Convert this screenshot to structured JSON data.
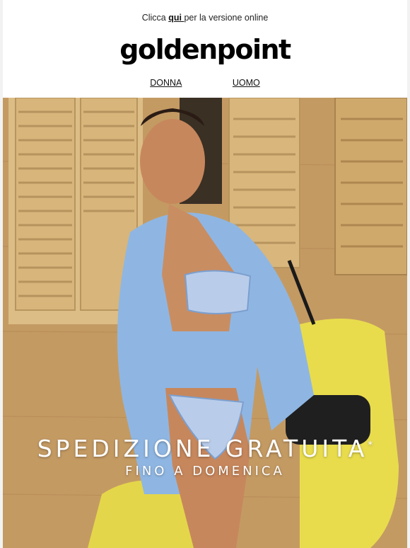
{
  "preheader": {
    "prefix": "Clicca ",
    "link": "qui ",
    "suffix": "per la versione online"
  },
  "brand": {
    "logo_text": "goldenpoint"
  },
  "nav": [
    {
      "label": "DONNA"
    },
    {
      "label": "UOMO"
    }
  ],
  "hero": {
    "headline": "SPEDIZIONE GRATUITA",
    "asterisk": "*",
    "subheadline": "FINO A DOMENICA"
  },
  "colors": {
    "wall": "#c9a06a",
    "shutter": "#e2c48e",
    "shirt": "#8fb6e2",
    "scooter": "#e9df4f",
    "text": "#ffffff"
  }
}
